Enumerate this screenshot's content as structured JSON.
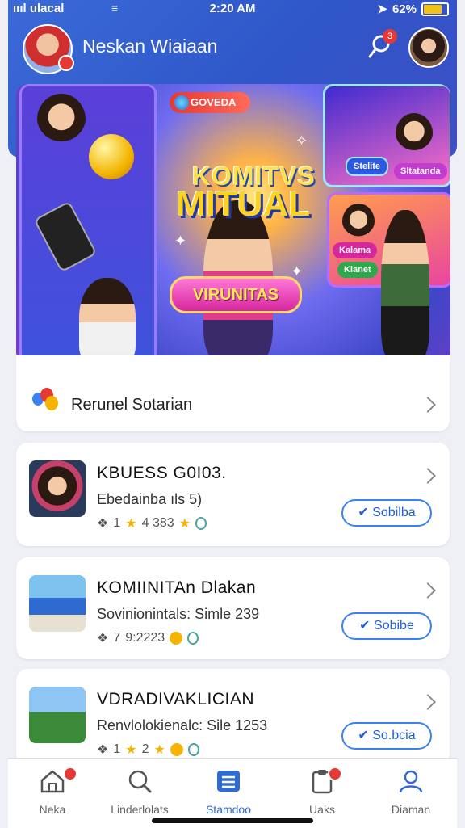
{
  "status_bar": {
    "carrier": "ıııl ulacal",
    "time": "2:20 AM",
    "battery": "62%"
  },
  "header": {
    "title": "Neskan Wiaiaan",
    "notification_count": "3"
  },
  "hero": {
    "title_line1": "KOMITVS",
    "title_line2": "MITUAL",
    "pill_label": "VIRUNITAS",
    "tag_top": "GOVEDA",
    "mini_tag_1": "Stelite",
    "mini_tag_2": "Sltatanda",
    "mini_tag_3": "Kalama",
    "mini_tag_4": "Klanet"
  },
  "promo": {
    "label": "Rerunel Sotarian"
  },
  "list": [
    {
      "title": "KBUESS G0I03.",
      "subtitle": "Ebedainba ıls 5)",
      "meta_count": "1",
      "meta_value": "4 383",
      "action": "Sobilba"
    },
    {
      "title": "KOMIINITAn Dlakan",
      "subtitle": "Sovinionintals: Simle 239",
      "meta_count": "7",
      "meta_value": "9:2223",
      "action": "Sobibe"
    },
    {
      "title": "VDRADIVAKLICIAN",
      "subtitle": "Renvlolokienalc: Sile 1253",
      "meta_count": "1",
      "meta_value": "2",
      "action": "So.bcia"
    }
  ],
  "nav": [
    {
      "label": "Neka",
      "icon": "home-icon"
    },
    {
      "label": "Linderlolats",
      "icon": "search-icon"
    },
    {
      "label": "Stamdoo",
      "icon": "list-icon"
    },
    {
      "label": "Uaks",
      "icon": "clipboard-icon"
    },
    {
      "label": "Diaman",
      "icon": "user-icon"
    }
  ],
  "colors": {
    "brand_blue": "#2f56c8",
    "accent_blue": "#3b82f6",
    "badge_red": "#e53935",
    "star_gold": "#f4b400"
  }
}
